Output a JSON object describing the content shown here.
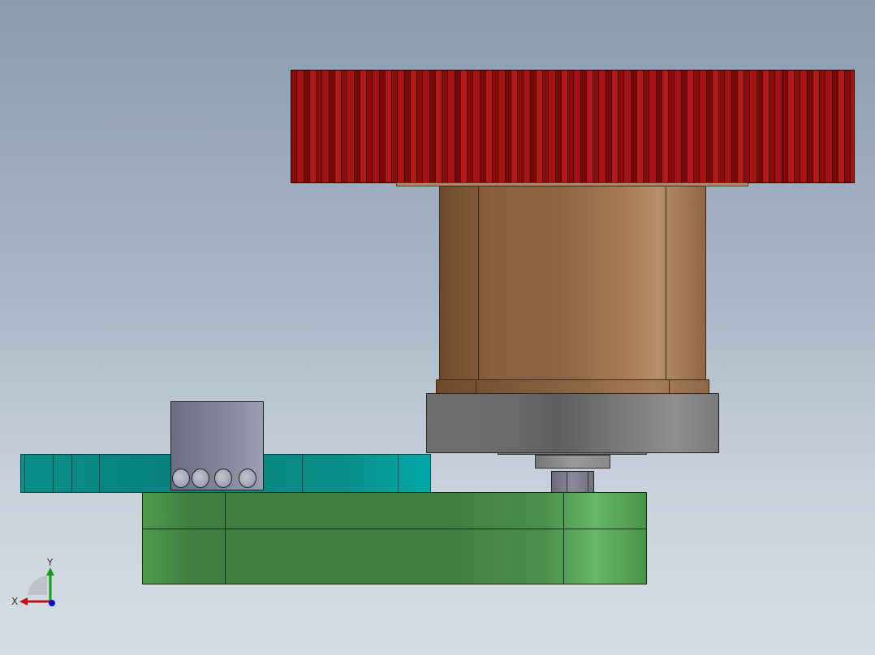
{
  "viewport": {
    "triad": {
      "x_label": "X",
      "y_label": "Y"
    }
  },
  "colors": {
    "gear": "#8e0a0a",
    "body": "#8b6443",
    "disk": "#7a7a7a",
    "teal_bar": "#0a8f8a",
    "bearing": "#7c8092",
    "block": "#3f7f3f",
    "x_axis": "#c01010",
    "y_axis": "#10a010",
    "z_axis": "#1010c0"
  }
}
